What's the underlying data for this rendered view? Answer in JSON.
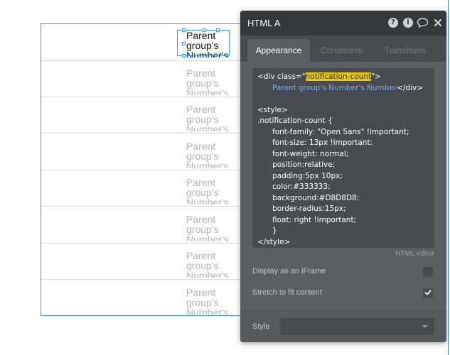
{
  "rows": [
    {
      "text": "Parent group's Number's"
    },
    {
      "text": "Parent group's Number's"
    },
    {
      "text": "Parent group's Number's"
    },
    {
      "text": "Parent group's Number's"
    },
    {
      "text": "Parent group's Number's"
    },
    {
      "text": "Parent group's Number's"
    },
    {
      "text": "Parent group's Number's"
    },
    {
      "text": "Parent group's Number's"
    }
  ],
  "panel": {
    "title": "HTML A",
    "header_icons": [
      "question-icon",
      "info-icon",
      "comment-icon",
      "close-icon"
    ],
    "tabs": [
      "Appearance",
      "Conditional",
      "Transitions"
    ],
    "active_tab": "Appearance",
    "code": {
      "l1_open": "<div class=\"",
      "l1_class": "notification-count",
      "l1_close": "\">",
      "l2_dynamic": "Parent group's Number's Number",
      "l2_close": "</div>",
      "l3": "<style>",
      "l4": ".notification-count {",
      "l5": "font-family: \"Open Sans\" !important;",
      "l6": "font-size: 13px !important;",
      "l7": "font-weight: normal;",
      "l8": "position:relative;",
      "l9": "padding:5px 10px;",
      "l10": "color:#333333;",
      "l11": "background:#D8D8D8;",
      "l12": "border-radius:15px;",
      "l13": "float: right !important;",
      "l14": "}",
      "l15": "</style>"
    },
    "html_editor_link": "HTML editor",
    "iframe_label": "Display as an iFrame",
    "iframe_checked": false,
    "stretch_label": "Stretch to fit content",
    "stretch_checked": true,
    "style_label": "Style",
    "style_value": ""
  },
  "colors": {
    "selection": "#3d92ea",
    "panel_bg": "#5a5f64",
    "header_bg": "#34383c",
    "highlight": "#e8c51a",
    "dynamic_text": "#73aaf0"
  }
}
